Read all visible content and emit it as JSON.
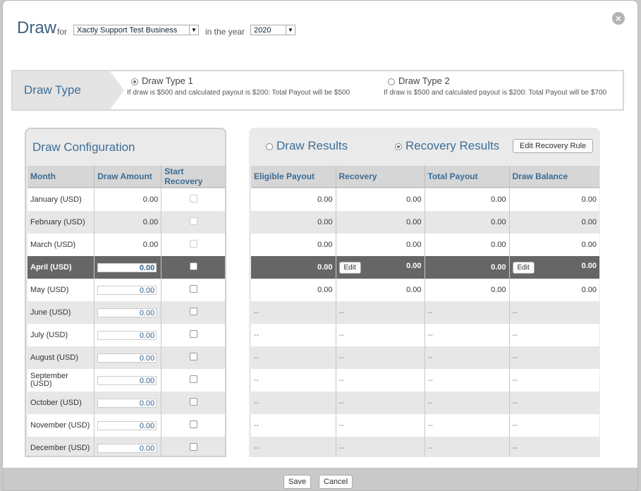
{
  "header": {
    "title": "Draw",
    "for_label": "for",
    "business": "Xactly Support Test Business",
    "year_label": "in the year",
    "year": "2020"
  },
  "draw_type": {
    "heading": "Draw Type",
    "options": [
      {
        "label": "Draw Type 1",
        "desc": "If draw is $500 and calculated payout is $200: Total Payout will be $500",
        "selected": true
      },
      {
        "label": "Draw Type 2",
        "desc": "If draw is $500 and calculated payout is $200: Total Payout will be $700",
        "selected": false
      }
    ]
  },
  "config": {
    "title": "Draw Configuration",
    "columns": [
      "Month",
      "Draw Amount",
      "Start Recovery"
    ],
    "rows": [
      {
        "month": "January (USD)",
        "amount": "0.00",
        "editable": false
      },
      {
        "month": "February (USD)",
        "amount": "0.00",
        "editable": false
      },
      {
        "month": "March (USD)",
        "amount": "0.00",
        "editable": false
      },
      {
        "month": "April (USD)",
        "amount": "0.00",
        "editable": true
      },
      {
        "month": "May (USD)",
        "amount": "0.00",
        "editable": true
      },
      {
        "month": "June (USD)",
        "amount": "0.00",
        "editable": true
      },
      {
        "month": "July (USD)",
        "amount": "0.00",
        "editable": true
      },
      {
        "month": "August (USD)",
        "amount": "0.00",
        "editable": true
      },
      {
        "month": "September (USD)",
        "amount": "0.00",
        "editable": true
      },
      {
        "month": "October (USD)",
        "amount": "0.00",
        "editable": true
      },
      {
        "month": "November (USD)",
        "amount": "0.00",
        "editable": true
      },
      {
        "month": "December (USD)",
        "amount": "0.00",
        "editable": true
      }
    ],
    "highlight_index": 3
  },
  "results": {
    "tabs": [
      {
        "label": "Draw Results",
        "selected": false
      },
      {
        "label": "Recovery Results",
        "selected": true
      }
    ],
    "edit_rule_label": "Edit Recovery Rule",
    "edit_label": "Edit",
    "columns": [
      "Eligible Payout",
      "Recovery",
      "Total Payout",
      "Draw Balance"
    ],
    "rows": [
      [
        "0.00",
        "0.00",
        "0.00",
        "0.00"
      ],
      [
        "0.00",
        "0.00",
        "0.00",
        "0.00"
      ],
      [
        "0.00",
        "0.00",
        "0.00",
        "0.00"
      ],
      [
        "0.00",
        "0.00",
        "0.00",
        "0.00"
      ],
      [
        "0.00",
        "0.00",
        "0.00",
        "0.00"
      ],
      [
        "--",
        "--",
        "--",
        "--"
      ],
      [
        "--",
        "--",
        "--",
        "--"
      ],
      [
        "--",
        "--",
        "--",
        "--"
      ],
      [
        "--",
        "--",
        "--",
        "--"
      ],
      [
        "--",
        "--",
        "--",
        "--"
      ],
      [
        "--",
        "--",
        "--",
        "--"
      ],
      [
        "--",
        "--",
        "--",
        "--"
      ]
    ]
  },
  "footer": {
    "save": "Save",
    "cancel": "Cancel"
  }
}
